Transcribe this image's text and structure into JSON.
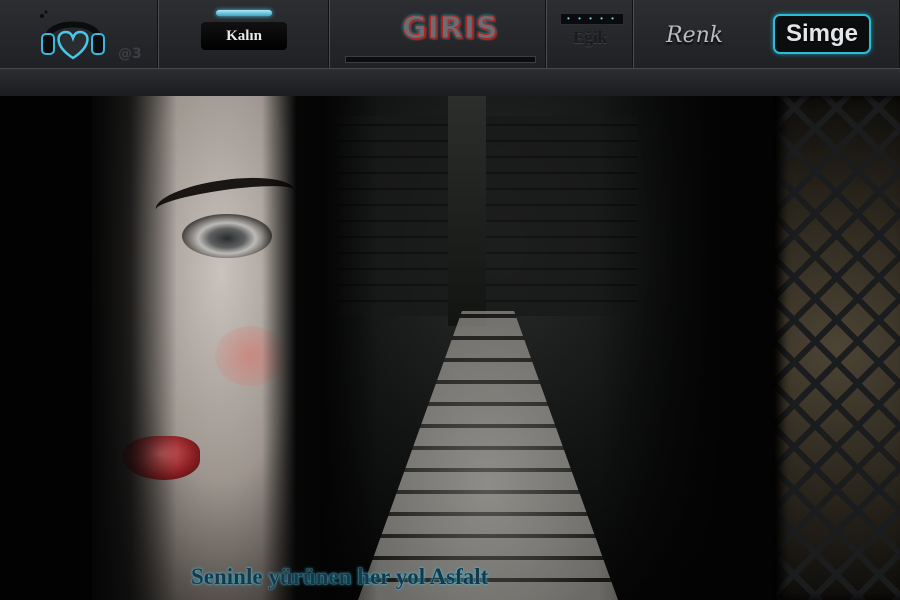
{
  "toolbar": {
    "logo_icon": "heart-headphones-icon",
    "counter": "@3",
    "kalin_label": "Kalın",
    "giris_label": "GIRIS",
    "egik_dots": "• • • • •",
    "egik_label": "Eğik",
    "renk_label": "Renk",
    "simge_label": "Simge"
  },
  "caption": {
    "text": "Seninle yürünen her yol Asfalt"
  },
  "colors": {
    "accent": "#2bbcd6",
    "giris_red": "#c11a1a",
    "bar_bg": "#252729"
  }
}
